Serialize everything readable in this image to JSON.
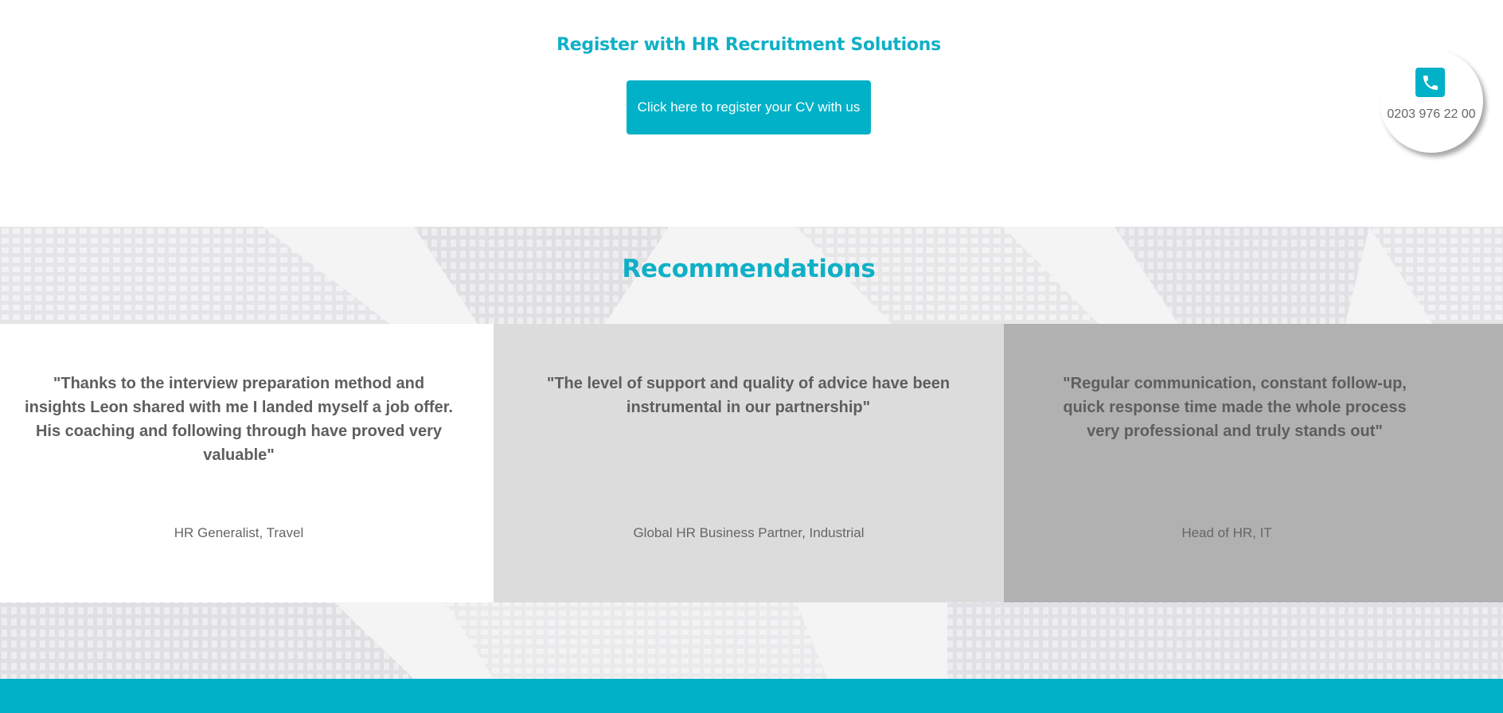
{
  "register": {
    "title": "Register with HR Recruitment Solutions",
    "button_label": "Click here to register your CV with us"
  },
  "contact": {
    "phone_icon": "phone-icon",
    "phone_number": "0203 976 22 00"
  },
  "recommendations": {
    "title": "Recommendations",
    "cards": [
      {
        "quote": "\"Thanks to the interview preparation method and insights Leon shared with me I landed myself a job offer. His coaching and following through have proved very valuable\"",
        "role": "HR Generalist, Travel"
      },
      {
        "quote": "\"The level of support and quality of advice have been instrumental in our partnership\"",
        "role": "Global HR Business Partner, Industrial"
      },
      {
        "quote": "\"Regular communication, constant follow-up, quick response time made the whole process very professional and truly stands out\"",
        "role": "Head of HR, IT"
      }
    ]
  },
  "colors": {
    "accent": "#00b1c7",
    "heading": "#0fb0c6",
    "text": "#5e5e5e",
    "card_1_bg": "#ffffff",
    "card_2_bg": "#dcdcdc",
    "card_3_bg": "#b1b1b1"
  }
}
